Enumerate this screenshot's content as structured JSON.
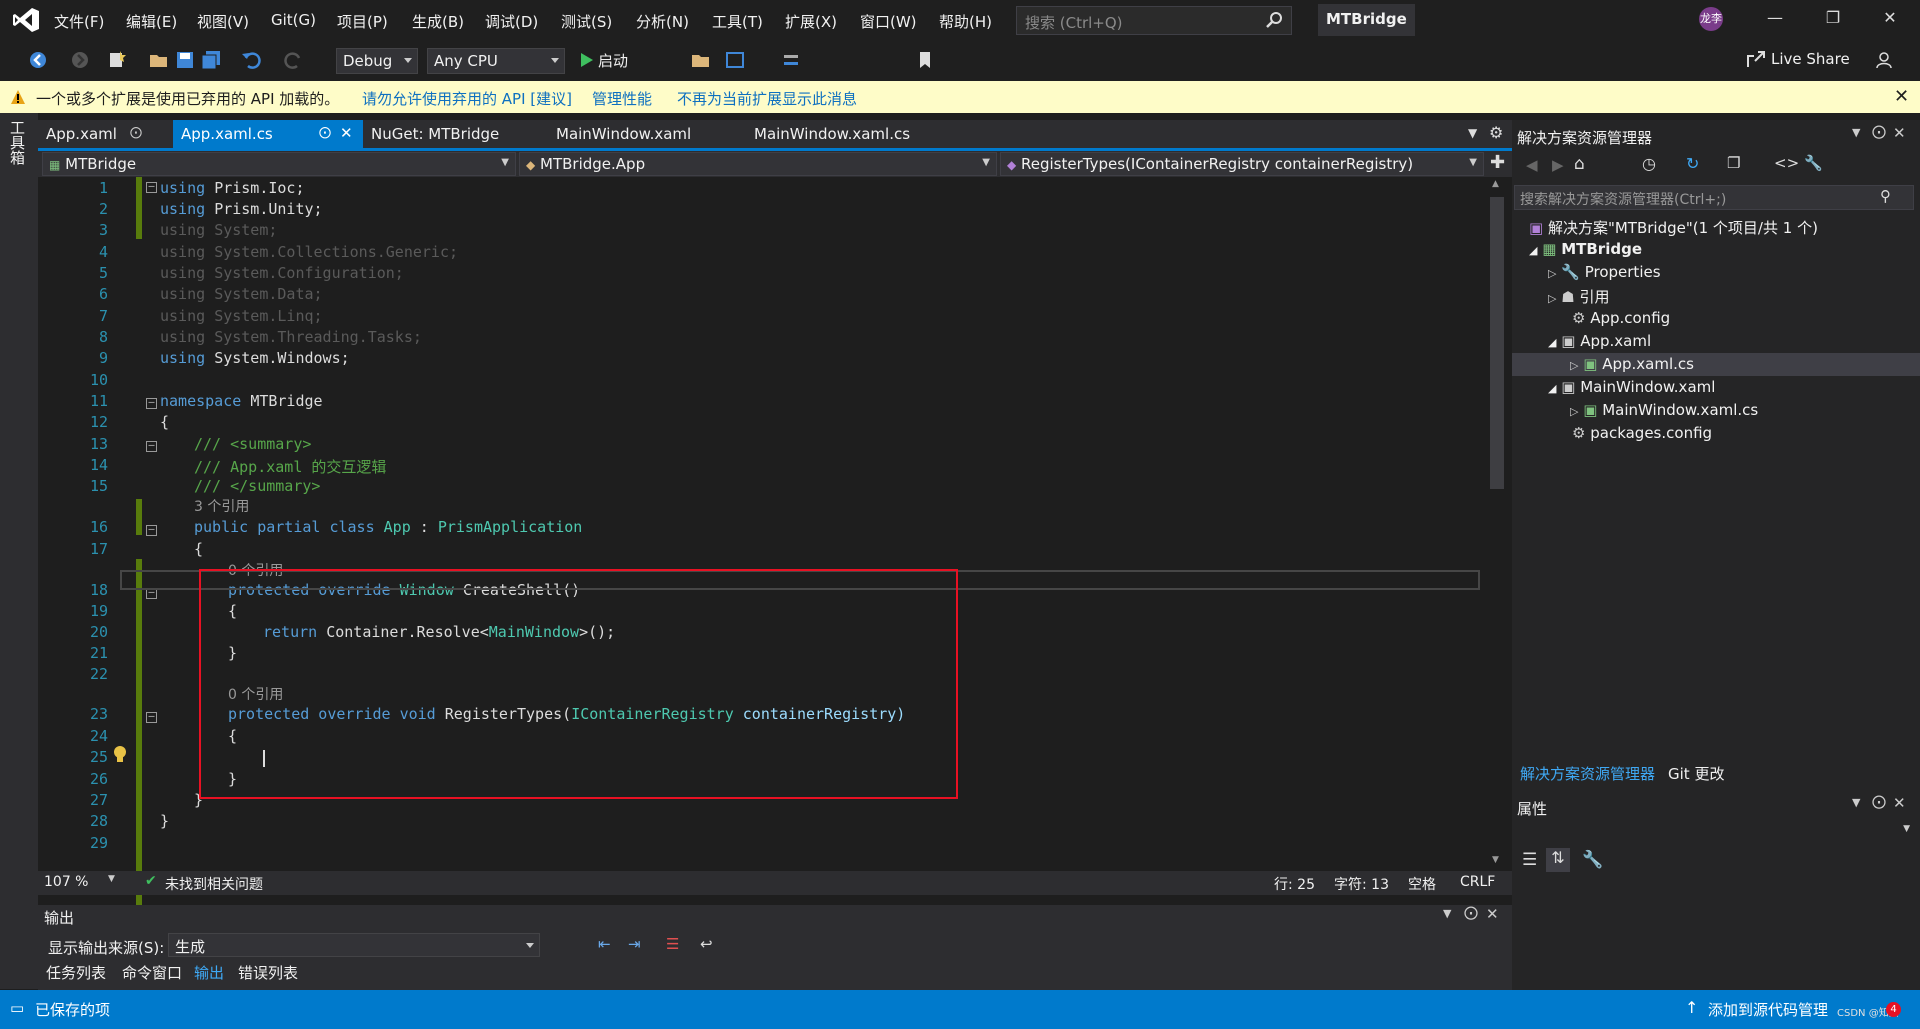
{
  "menu": [
    "文件(F)",
    "编辑(E)",
    "视图(V)",
    "Git(G)",
    "项目(P)",
    "生成(B)",
    "调试(D)",
    "测试(S)",
    "分析(N)",
    "工具(T)",
    "扩展(X)",
    "窗口(W)",
    "帮助(H)"
  ],
  "search_placeholder": "搜索 (Ctrl+Q)",
  "solution_title": "MTBridge",
  "user_initials": "龙李",
  "toolbar": {
    "config": "Debug",
    "platform": "Any CPU",
    "start_label": "启动",
    "live_share": "Live Share"
  },
  "infobar": {
    "message": "一个或多个扩展是使用已弃用的 API 加载的。",
    "link1": "请勿允许使用弃用的 API [建议]",
    "link2": "管理性能",
    "link3": "不再为当前扩展显示此消息"
  },
  "toolbox_label": "工具箱",
  "tabs": [
    {
      "label": "App.xaml"
    },
    {
      "label": "App.xaml.cs"
    },
    {
      "label": "NuGet: MTBridge"
    },
    {
      "label": "MainWindow.xaml"
    },
    {
      "label": "MainWindow.xaml.cs"
    }
  ],
  "nav": {
    "project": "MTBridge",
    "class": "MTBridge.App",
    "member": "RegisterTypes(IContainerRegistry containerRegistry)"
  },
  "code": {
    "l1": "Prism.Ioc;",
    "l2": "Prism.Unity;",
    "l3": "System;",
    "l4": "System.Collections.Generic;",
    "l5": "System.Configuration;",
    "l6": "System.Data;",
    "l7": "System.Linq;",
    "l8": "System.Threading.Tasks;",
    "l9": "System.Windows;",
    "using": "using",
    "namespace": "namespace",
    "ns_name": "MTBridge",
    "sum_open": "/// <summary>",
    "sum_text": "/// App.xaml 的交互逻辑",
    "sum_close": "/// </summary>",
    "ref3": "3 个引用",
    "ref0": "0 个引用",
    "class_decl_kw": "public partial class",
    "class_name": "App",
    "base_class": "PrismApplication",
    "prot_override": "protected override",
    "window_type": "Window",
    "create_shell": "CreateShell()",
    "return_kw": "return",
    "resolve": "Container.Resolve",
    "main_window": "MainWindow",
    "resolve_end": "();",
    "void_kw": "void",
    "register": "RegisterTypes(",
    "icr": "IContainerRegistry",
    "param": "containerRegistry)"
  },
  "line_numbers": [
    "1",
    "2",
    "3",
    "4",
    "5",
    "6",
    "7",
    "8",
    "9",
    "10",
    "11",
    "12",
    "13",
    "14",
    "15",
    "16",
    "17",
    "18",
    "19",
    "20",
    "21",
    "22",
    "23",
    "24",
    "25",
    "26",
    "27",
    "28",
    "29"
  ],
  "editor_status": {
    "zoom": "107 %",
    "issues": "未找到相关问题",
    "line": "行: 25",
    "char": "字符: 13",
    "spaces": "空格",
    "eol": "CRLF"
  },
  "output": {
    "title": "输出",
    "source_label": "显示输出来源(S):",
    "source_value": "生成",
    "tabs": [
      "任务列表",
      "命令窗口",
      "输出",
      "错误列表"
    ]
  },
  "solution_explorer": {
    "title": "解决方案资源管理器",
    "search_placeholder": "搜索解决方案资源管理器(Ctrl+;)",
    "solution": "解决方案\"MTBridge\"(1 个项目/共 1 个)",
    "project": "MTBridge",
    "items": [
      "Properties",
      "引用",
      "App.config",
      "App.xaml",
      "App.xaml.cs",
      "MainWindow.xaml",
      "MainWindow.xaml.cs",
      "packages.config"
    ],
    "bottom_tabs": [
      "解决方案资源管理器",
      "Git 更改"
    ]
  },
  "properties": {
    "title": "属性"
  },
  "statusbar": {
    "saved": "已保存的项",
    "source_control": "添加到源代码管理",
    "watermark": "CSDN @知阳",
    "badge": "4"
  },
  "colors": {
    "accent": "#007acc",
    "highlight_box": "#e81123",
    "info_bg": "#fefcc8"
  }
}
